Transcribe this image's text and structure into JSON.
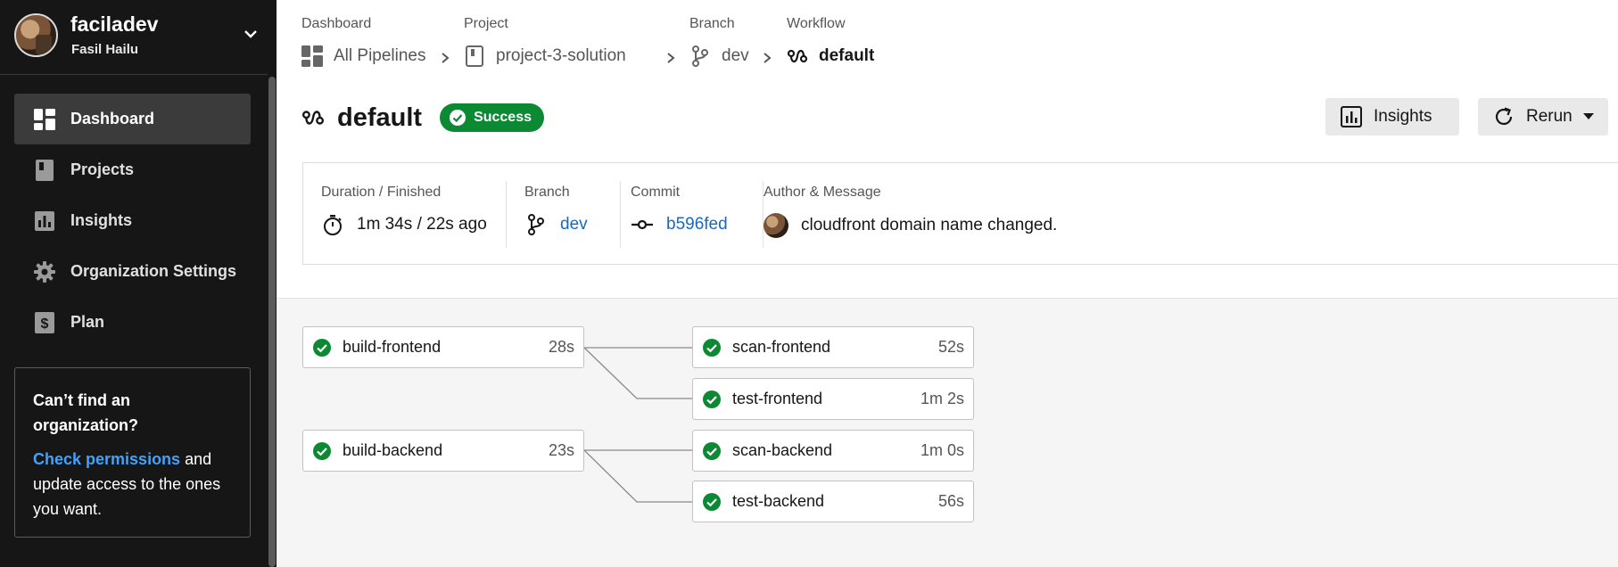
{
  "colors": {
    "sidebar_bg": "#161616",
    "active_nav_bg": "#3b3b3b",
    "success": "#0c8a33",
    "link": "#1769c2",
    "help_link": "#3fa3ff",
    "graph_bg": "#f5f5f5"
  },
  "sidebar": {
    "org_name": "faciladev",
    "user_name": "Fasil Hailu",
    "items": [
      {
        "label": "Dashboard",
        "icon": "dashboard-icon",
        "active": true
      },
      {
        "label": "Projects",
        "icon": "project-icon",
        "active": false
      },
      {
        "label": "Insights",
        "icon": "insights-icon",
        "active": false
      },
      {
        "label": "Organization Settings",
        "icon": "gear-icon",
        "active": false
      },
      {
        "label": "Plan",
        "icon": "dollar-icon",
        "active": false
      }
    ],
    "help": {
      "title": "Can’t find an organization?",
      "link_text": "Check permissions",
      "body_rest": " and update access to the ones you want."
    }
  },
  "breadcrumb": {
    "dashboard": {
      "label": "Dashboard",
      "value": "All Pipelines"
    },
    "project": {
      "label": "Project",
      "value": "project-3-solution"
    },
    "branch": {
      "label": "Branch",
      "value": "dev"
    },
    "workflow": {
      "label": "Workflow",
      "value": "default"
    }
  },
  "header": {
    "title": "default",
    "status": "Success",
    "insights_button": "Insights",
    "rerun_button": "Rerun"
  },
  "meta": {
    "duration": {
      "label": "Duration / Finished",
      "value": "1m 34s / 22s ago"
    },
    "branch": {
      "label": "Branch",
      "value": "dev"
    },
    "commit": {
      "label": "Commit",
      "value": "b596fed"
    },
    "author": {
      "label": "Author & Message",
      "value": "cloudfront domain name changed."
    }
  },
  "jobs": [
    {
      "name": "build-frontend",
      "time": "28s",
      "status": "success"
    },
    {
      "name": "scan-frontend",
      "time": "52s",
      "status": "success"
    },
    {
      "name": "test-frontend",
      "time": "1m 2s",
      "status": "success"
    },
    {
      "name": "build-backend",
      "time": "23s",
      "status": "success"
    },
    {
      "name": "scan-backend",
      "time": "1m 0s",
      "status": "success"
    },
    {
      "name": "test-backend",
      "time": "56s",
      "status": "success"
    }
  ]
}
